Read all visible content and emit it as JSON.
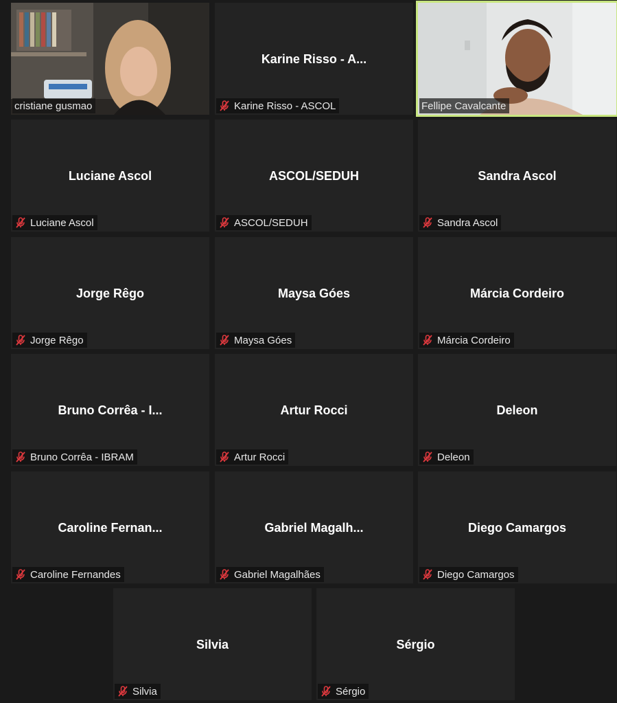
{
  "colors": {
    "tile_bg": "#232323",
    "page_bg": "#1a1a1a",
    "active_border": "#c8e680",
    "muted_icon": "#e0393e"
  },
  "participants": [
    {
      "id": "cristiane",
      "display": "",
      "label": "cristiane gusmao",
      "muted": false,
      "video": true
    },
    {
      "id": "karine",
      "display": "Karine Risso - A...",
      "label": "Karine Risso - ASCOL",
      "muted": true,
      "video": false
    },
    {
      "id": "fellipe",
      "display": "",
      "label": "Fellipe Cavalcante",
      "muted": false,
      "video": true,
      "active": true
    },
    {
      "id": "luciane",
      "display": "Luciane Ascol",
      "label": "Luciane Ascol",
      "muted": true,
      "video": false
    },
    {
      "id": "ascol",
      "display": "ASCOL/SEDUH",
      "label": "ASCOL/SEDUH",
      "muted": true,
      "video": false
    },
    {
      "id": "sandra",
      "display": "Sandra Ascol",
      "label": "Sandra Ascol",
      "muted": true,
      "video": false
    },
    {
      "id": "jorge",
      "display": "Jorge Rêgo",
      "label": "Jorge Rêgo",
      "muted": true,
      "video": false
    },
    {
      "id": "maysa",
      "display": "Maysa Góes",
      "label": "Maysa Góes",
      "muted": true,
      "video": false
    },
    {
      "id": "marcia",
      "display": "Márcia Cordeiro",
      "label": "Márcia Cordeiro",
      "muted": true,
      "video": false
    },
    {
      "id": "bruno",
      "display": "Bruno Corrêa - I...",
      "label": "Bruno Corrêa - IBRAM",
      "muted": true,
      "video": false
    },
    {
      "id": "artur",
      "display": "Artur Rocci",
      "label": "Artur Rocci",
      "muted": true,
      "video": false
    },
    {
      "id": "deleon",
      "display": "Deleon",
      "label": "Deleon",
      "muted": true,
      "video": false
    },
    {
      "id": "caroline",
      "display": "Caroline  Fernan...",
      "label": "Caroline Fernandes",
      "muted": true,
      "video": false
    },
    {
      "id": "gabriel",
      "display": "Gabriel  Magalh...",
      "label": "Gabriel Magalhães",
      "muted": true,
      "video": false
    },
    {
      "id": "diego",
      "display": "Diego Camargos",
      "label": "Diego Camargos",
      "muted": true,
      "video": false
    },
    {
      "id": "silvia",
      "display": "Silvia",
      "label": "Silvia",
      "muted": true,
      "video": false
    },
    {
      "id": "sergio",
      "display": "Sérgio",
      "label": "Sérgio",
      "muted": true,
      "video": false
    }
  ]
}
